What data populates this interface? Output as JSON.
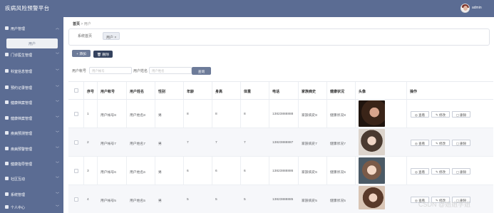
{
  "app": {
    "title": "疾病风险预警平台",
    "user": "admin"
  },
  "sidebar": {
    "items": [
      {
        "label": "用户管理",
        "icon": "user-manage-icon"
      },
      {
        "label": "门诊医生管理",
        "icon": "flag-icon"
      },
      {
        "label": "科室信息管理",
        "icon": "grid-icon"
      },
      {
        "label": "预约记录管理",
        "icon": "grid-icon"
      },
      {
        "label": "健康档案管理",
        "icon": "person-icon"
      },
      {
        "label": "健康档案管理",
        "icon": "person-icon"
      },
      {
        "label": "疾病预测管理",
        "icon": "send-icon"
      },
      {
        "label": "疾病预警管理",
        "icon": "grid-icon"
      },
      {
        "label": "健康指导管理",
        "icon": "grid-icon"
      },
      {
        "label": "社区互动",
        "icon": "grid-icon"
      },
      {
        "label": "系统管理",
        "icon": "person-icon"
      },
      {
        "label": "个人中心",
        "icon": "grid-icon"
      }
    ],
    "active_sub": "用户"
  },
  "breadcrumb": {
    "home": "首页",
    "sep": ">",
    "current": "用户"
  },
  "tags": {
    "home": "系统首页",
    "active": "用户 ×"
  },
  "toolbar": {
    "add": "+ 添加",
    "delete": "🗑 删除"
  },
  "search": {
    "account_label": "用户帐号",
    "account_placeholder": "用户帐号",
    "name_label": "用户姓名",
    "name_placeholder": "用户姓名",
    "button": "查询"
  },
  "table": {
    "headers": [
      "序号",
      "用户帐号",
      "用户姓名",
      "性别",
      "年龄",
      "身高",
      "体重",
      "电话",
      "家族病史",
      "健康状况",
      "头像",
      "操作"
    ],
    "rows": [
      {
        "index": "1",
        "account": "用户帐号8",
        "name": "用户姓名8",
        "gender": "男",
        "age": "8",
        "height": "8",
        "weight": "8",
        "phone": "13823888888",
        "history": "家族病史8",
        "health": "健康状况8"
      },
      {
        "index": "2",
        "account": "用户帐号7",
        "name": "用户姓名7",
        "gender": "男",
        "age": "7",
        "height": "7",
        "weight": "7",
        "phone": "13823888887",
        "history": "家族病史7",
        "health": "健康状况7"
      },
      {
        "index": "3",
        "account": "用户帐号6",
        "name": "用户姓名6",
        "gender": "男",
        "age": "6",
        "height": "6",
        "weight": "6",
        "phone": "13823888886",
        "history": "家族病史6",
        "health": "健康状况6"
      },
      {
        "index": "4",
        "account": "用户帐号5",
        "name": "用户姓名5",
        "gender": "男",
        "age": "5",
        "height": "5",
        "weight": "5",
        "phone": "13823888885",
        "history": "家族病史5",
        "health": "健康状况5"
      }
    ],
    "actions": {
      "view": "查看",
      "edit": "修改",
      "delete": "删除"
    }
  },
  "watermark": "CSDN @姐姐学姐",
  "colors": {
    "sidebar": "#5b6c93",
    "topbar": "#5b6c93",
    "primary_button": "#6d7b99",
    "dark_button": "#34425e"
  }
}
